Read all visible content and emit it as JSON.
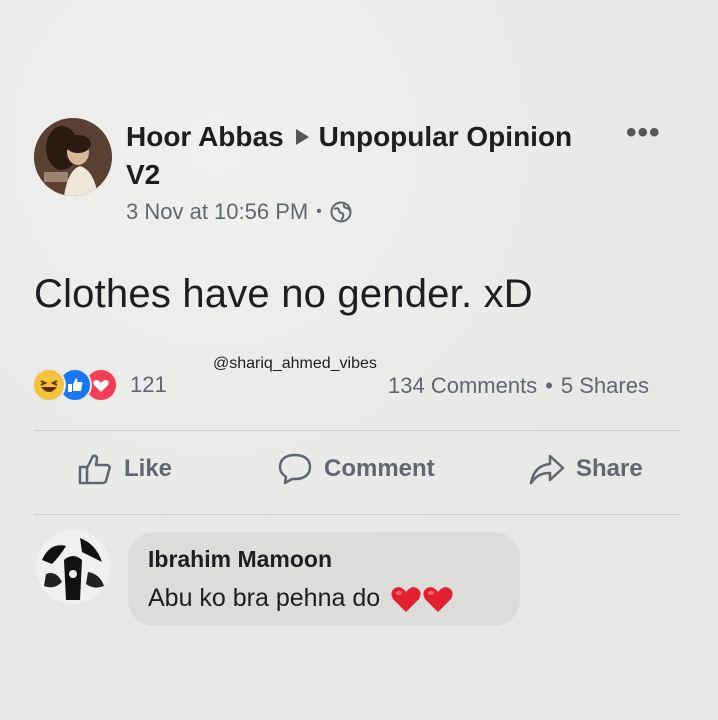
{
  "post": {
    "author": "Hoor Abbas",
    "group": "Unpopular Opinion V2",
    "more_label": "•••",
    "timestamp": "3 Nov at 10:56 PM",
    "timestamp_separator": "•",
    "privacy_icon": "globe-icon",
    "text": "Clothes have no gender. xD",
    "watermark": "@shariq_ahmed_vibes"
  },
  "stats": {
    "reactions": [
      "haha-reaction-icon",
      "like-reaction-icon",
      "love-reaction-icon"
    ],
    "reaction_count": "121",
    "comments": "134 Comments",
    "separator": "•",
    "shares": "5 Shares"
  },
  "actions": {
    "like_label": "Like",
    "like_icon": "thumbs-up-icon",
    "comment_label": "Comment",
    "comment_icon": "speech-bubble-icon",
    "share_label": "Share",
    "share_icon": "share-arrow-icon"
  },
  "comment": {
    "author": "Ibrahim Mamoon",
    "text": "Abu ko bra pehna do",
    "emoji_icons": [
      "red-heart-icon",
      "red-heart-icon"
    ]
  },
  "colors": {
    "background": "#e8e8e6",
    "text_primary": "#1c1e21",
    "text_secondary": "#606770",
    "comment_bubble": "#dcdcda",
    "like_blue": "#1877f2",
    "love_red": "#f33e58",
    "haha_yellow": "#f5c33b",
    "heart_red": "#e0202f"
  }
}
